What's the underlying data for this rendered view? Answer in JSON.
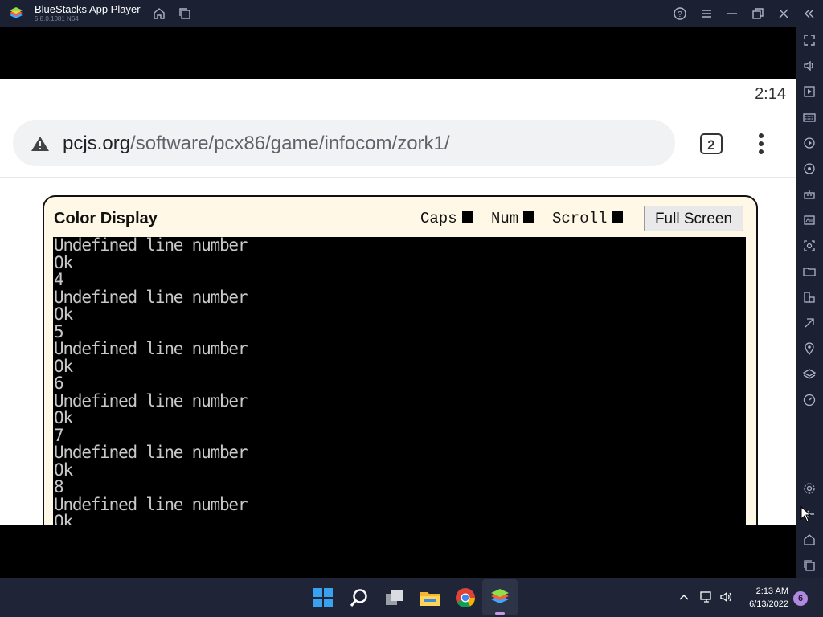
{
  "titlebar": {
    "app_title": "BlueStacks App Player",
    "app_version": "5.8.0.1081 N64"
  },
  "android": {
    "status_time": "2:14",
    "browser": {
      "url_host": "pcjs.org",
      "url_path": "/software/pcx86/game/infocom/zork1/",
      "tab_count": "2"
    },
    "panel": {
      "title": "Color Display",
      "caps_label": "Caps",
      "num_label": "Num",
      "scroll_label": "Scroll",
      "fullscreen_label": "Full Screen",
      "screen_lines": [
        "Undefined line number",
        "Ok",
        "4",
        "Undefined line number",
        "Ok",
        "5",
        "Undefined line number",
        "Ok",
        "6",
        "Undefined line number",
        "Ok",
        "7",
        "Undefined line number",
        "Ok",
        "8",
        "Undefined line number",
        "Ok"
      ]
    }
  },
  "taskbar": {
    "clock_time": "2:13 AM",
    "clock_date": "6/13/2022",
    "notification_count": "6"
  },
  "icons": {
    "titlebar": [
      "home-icon",
      "multi-instance-icon",
      "help-icon",
      "menu-icon",
      "minimize-icon",
      "restore-icon",
      "close-icon",
      "collapse-sidebar-icon"
    ],
    "sidebar": [
      "fullscreen-icon",
      "volume-icon",
      "media-icon",
      "keyboard-icon",
      "macro-icon",
      "rotate-icon",
      "gamepad-icon",
      "apk-icon",
      "screenshot-icon",
      "folder-icon",
      "multi-device-icon",
      "eco-icon",
      "location-icon",
      "layers-icon",
      "speed-icon",
      "settings-icon",
      "back-icon",
      "home-icon",
      "recents-icon"
    ]
  },
  "colors": {
    "chrome_dark": "#1b2033",
    "panel_bg": "#fff8e6",
    "terminal_text": "#c8c8c8"
  }
}
